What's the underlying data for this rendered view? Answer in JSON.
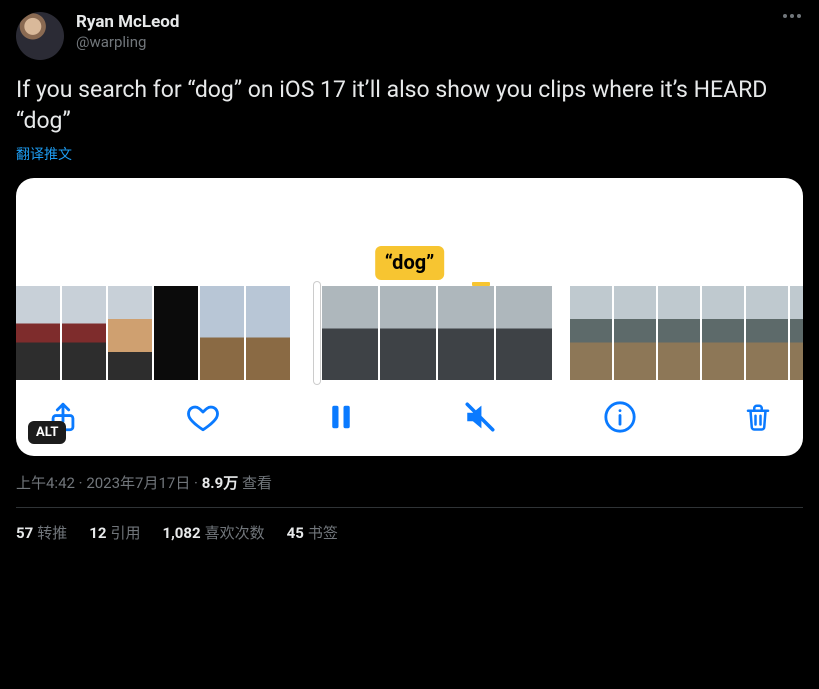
{
  "author": {
    "name": "Ryan McLeod",
    "handle": "@warpling"
  },
  "body": "If you search for “dog” on iOS 17 it’ll also show you clips where it’s HEARD “dog”",
  "translate_label": "翻译推文",
  "media": {
    "caption_pill": "“dog”",
    "alt_badge": "ALT",
    "toolbar": {
      "share": "share-icon",
      "like": "heart-icon",
      "pause": "pause-icon",
      "mute": "mute-icon",
      "info": "info-icon",
      "trash": "trash-icon"
    }
  },
  "meta": {
    "time": "上午4:42",
    "sep1": " · ",
    "date": "2023年7月17日",
    "sep2": " · ",
    "views_num": "8.9万",
    "views_label": " 查看"
  },
  "stats": {
    "retweets": {
      "n": "57",
      "label": "转推"
    },
    "quotes": {
      "n": "12",
      "label": "引用"
    },
    "likes": {
      "n": "1,082",
      "label": "喜欢次数"
    },
    "bookmarks": {
      "n": "45",
      "label": "书签"
    }
  }
}
